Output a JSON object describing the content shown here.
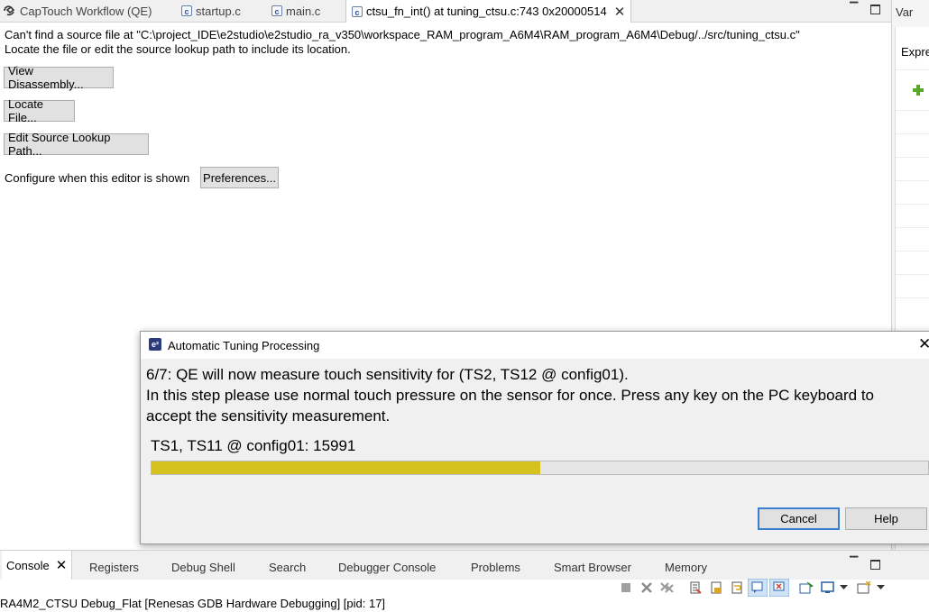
{
  "editor_tabs": [
    {
      "label": "CapTouch Workflow (QE)",
      "icon": "captouch-icon"
    },
    {
      "label": "startup.c",
      "icon": "c-file-icon"
    },
    {
      "label": "main.c",
      "icon": "c-file-icon"
    },
    {
      "label": "ctsu_fn_int() at tuning_ctsu.c:743 0x20000514",
      "icon": "c-file-icon",
      "active": true
    }
  ],
  "editor": {
    "message_line1": "Can't find a source file at \"C:\\project_IDE\\e2studio\\e2studio_ra_v350\\workspace_RAM_program_A6M4\\RAM_program_A6M4\\Debug/../src/tuning_ctsu.c\"",
    "message_line2": "Locate the file or edit the source lookup path to include its location.",
    "view_disassembly_label": "View Disassembly...",
    "locate_file_label": "Locate File...",
    "edit_lookup_label": "Edit Source Lookup Path...",
    "configure_text": "Configure when this editor is shown",
    "preferences_label": "Preferences..."
  },
  "right_panel": {
    "tab_label": "Var",
    "header_label": "Expre"
  },
  "dialog": {
    "title": "Automatic Tuning Processing",
    "step_line": "6/7: QE will now measure touch sensitivity for (TS2, TS12 @ config01).",
    "instruction_line1": "In this step please use normal touch pressure on the sensor for once. Press any key on the PC keyboard to",
    "instruction_line2": "accept the sensitivity measurement.",
    "measurement_text": "TS1, TS11 @ config01: 15991",
    "progress_fraction": 0.5,
    "progress_color": "#d6c21e",
    "cancel_label": "Cancel",
    "help_label": "Help"
  },
  "console": {
    "tabs": [
      "Console",
      "Registers",
      "Debug Shell",
      "Search",
      "Debugger Console",
      "Problems",
      "Smart Browser",
      "Memory"
    ],
    "status_line": "RA4M2_CTSU Debug_Flat [Renesas GDB Hardware Debugging]  [pid: 17]"
  },
  "colors": {
    "accent": "#3c7fd1",
    "button_face": "#e1e1e1",
    "panel_bg": "#f0f0f0"
  }
}
